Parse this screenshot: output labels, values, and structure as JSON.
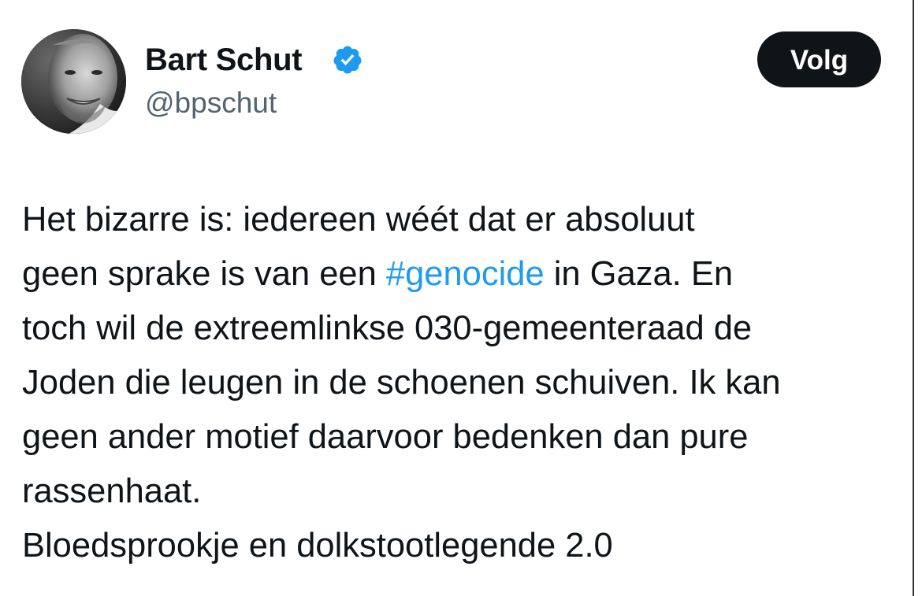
{
  "author": {
    "name": "Bart Schut",
    "handle": "@bpschut",
    "verified_icon": "verified-badge-icon",
    "verified_color": "#1d9bf0"
  },
  "follow_button": {
    "label": "Volg"
  },
  "tweet": {
    "line1": "Het bizarre is: iedereen wéét dat er absoluut",
    "line2_before": "geen sprake is van een ",
    "line2_hashtag": "#genocide",
    "line2_after": " in Gaza. En",
    "line3": "toch wil de extreemlinkse 030-gemeenteraad de",
    "line4": "Joden die leugen in de schoenen schuiven. Ik kan",
    "line5": "geen ander motief daarvoor bedenken dan pure",
    "line6": "rassenhaat.",
    "line7": "Bloedsprookje en dolkstootlegende 2.0"
  },
  "colors": {
    "text": "#0f1419",
    "secondary": "#536471",
    "link": "#1d9bf0",
    "button_bg": "#0f1419"
  }
}
